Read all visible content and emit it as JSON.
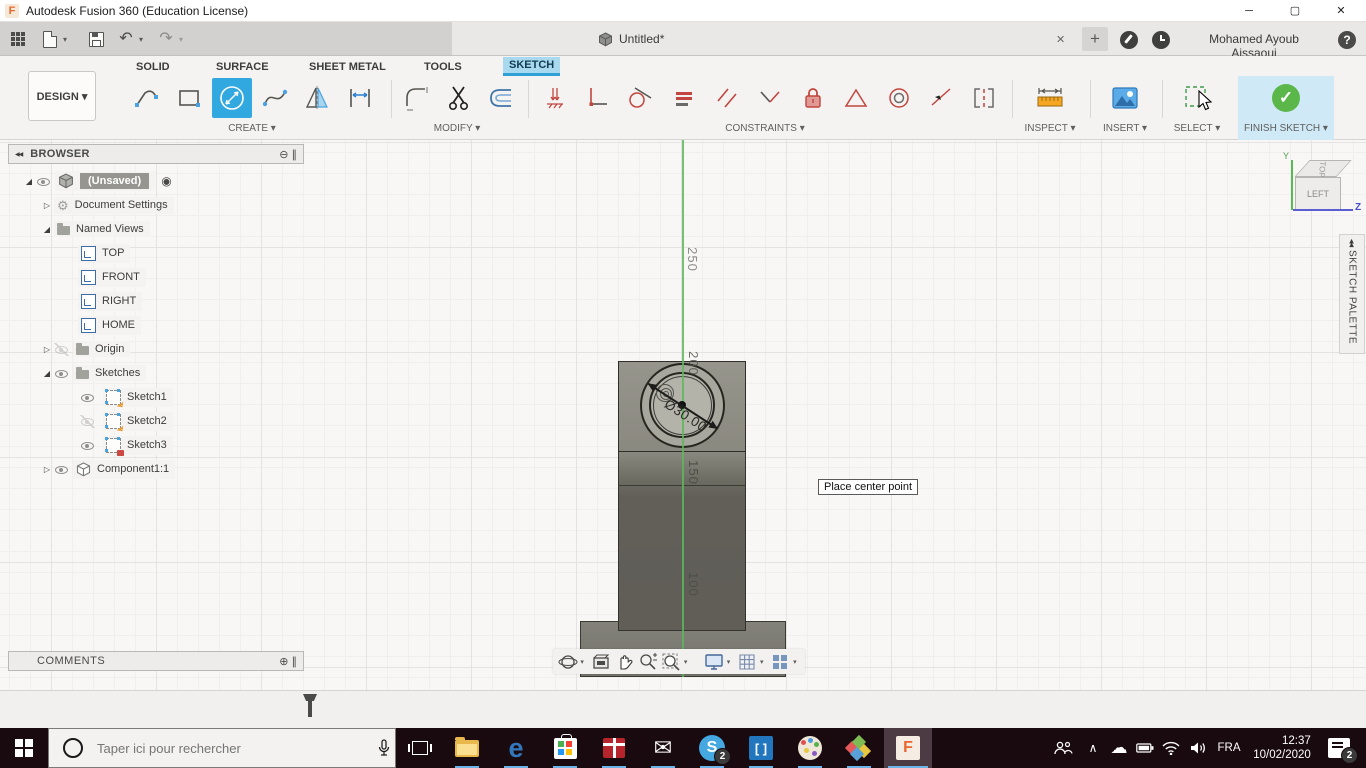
{
  "window": {
    "title": "Autodesk Fusion 360 (Education License)"
  },
  "glyphs": {
    "caret": "▾",
    "min": "─",
    "max": "▢",
    "close": "✕",
    "plus": "+",
    "help": "?",
    "undo": "↶",
    "redo": "↷",
    "collapse": "◀◀",
    "minus_circle": "⊖",
    "plus_circle": "⊕",
    "handle": "∥",
    "radio": "◉",
    "tri_open": "◢",
    "tri_closed": "▷",
    "gear": "⚙",
    "check": "✓",
    "chevron_up": "∧",
    "cloud": "☁",
    "mail": "✉"
  },
  "tab": {
    "label": "Untitled*"
  },
  "account": {
    "name": "Mohamed Ayoub Aissaoui"
  },
  "ribbon": {
    "design": "DESIGN ▾",
    "tabs": [
      "SOLID",
      "SURFACE",
      "SHEET METAL",
      "TOOLS",
      "SKETCH"
    ],
    "groups": {
      "create": "CREATE ▾",
      "modify": "MODIFY ▾",
      "constraints": "CONSTRAINTS ▾",
      "inspect": "INSPECT ▾",
      "insert": "INSERT ▾",
      "select": "SELECT ▾",
      "finish": "FINISH SKETCH ▾"
    }
  },
  "browser": {
    "title": "BROWSER",
    "root": "(Unsaved)",
    "doc_settings": "Document Settings",
    "named_views": "Named Views",
    "views": [
      "TOP",
      "FRONT",
      "RIGHT",
      "HOME"
    ],
    "origin": "Origin",
    "sketches": "Sketches",
    "sketch_items": [
      "Sketch1",
      "Sketch2",
      "Sketch3"
    ],
    "component": "Component1:1"
  },
  "comments": {
    "title": "COMMENTS"
  },
  "viewcube": {
    "top": "TOP",
    "front": "LEFT",
    "axis_y": "Y",
    "axis_z": "Z"
  },
  "palette": {
    "title": "SKETCH PALETTE"
  },
  "canvas": {
    "tooltip": "Place center point",
    "dimension": "Ø30.00",
    "axis_labels": [
      "250",
      "200",
      "150",
      "100"
    ]
  },
  "playback": [
    "▮◀",
    "◀▮",
    "▶",
    "▮▶",
    "▶▮"
  ],
  "taskbar": {
    "search_placeholder": "Taper ici pour rechercher",
    "language": "FRA",
    "time": "12:37",
    "date": "10/02/2020",
    "skype_badge": "2",
    "notif_badge": "2",
    "edge": "e",
    "skype": "S",
    "brackets": "[ ]",
    "fusion": "F"
  }
}
